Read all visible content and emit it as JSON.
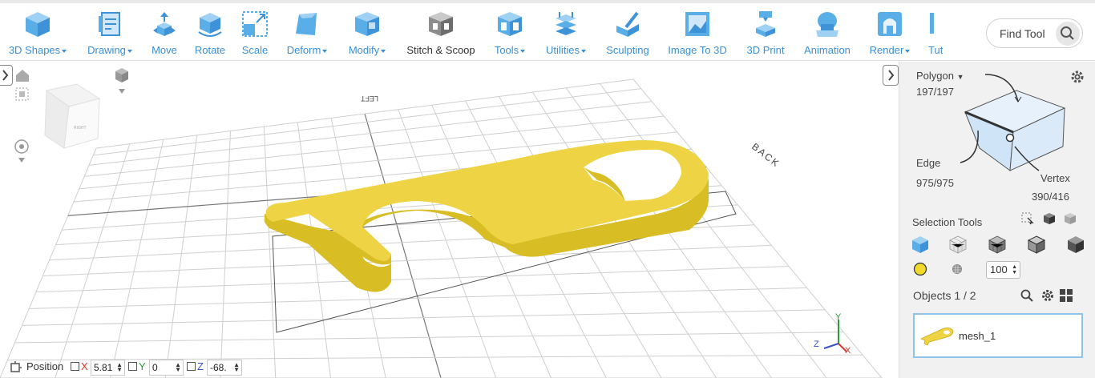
{
  "toolbar": {
    "tools": [
      {
        "label": "3D Shapes",
        "icon": "cube-icon",
        "dropdown": true
      },
      {
        "label": "Drawing",
        "icon": "drawing-icon",
        "dropdown": true
      },
      {
        "label": "Move",
        "icon": "move-icon",
        "dropdown": false
      },
      {
        "label": "Rotate",
        "icon": "rotate-icon",
        "dropdown": false
      },
      {
        "label": "Scale",
        "icon": "scale-icon",
        "dropdown": false
      },
      {
        "label": "Deform",
        "icon": "deform-icon",
        "dropdown": true
      },
      {
        "label": "Modify",
        "icon": "modify-icon",
        "dropdown": true
      },
      {
        "label": "Stitch & Scoop",
        "icon": "stitch-scoop-icon",
        "dropdown": false
      },
      {
        "label": "Tools",
        "icon": "tools-icon",
        "dropdown": true
      },
      {
        "label": "Utilities",
        "icon": "utilities-icon",
        "dropdown": true
      },
      {
        "label": "Sculpting",
        "icon": "sculpting-icon",
        "dropdown": false
      },
      {
        "label": "Image To 3D",
        "icon": "image-to-3d-icon",
        "dropdown": false
      },
      {
        "label": "3D Print",
        "icon": "3d-print-icon",
        "dropdown": false
      },
      {
        "label": "Animation",
        "icon": "animation-icon",
        "dropdown": false
      },
      {
        "label": "Render",
        "icon": "render-icon",
        "dropdown": true
      },
      {
        "label": "Tut",
        "icon": "tutorials-icon",
        "dropdown": false
      }
    ],
    "find_tool": "Find Tool"
  },
  "viewport": {
    "labels": {
      "left": "LEFT",
      "back": "BACK",
      "right": "RIGHT"
    },
    "axis_labels": {
      "x": "X",
      "y": "Y",
      "z": "Z"
    },
    "model_color": "#eed444"
  },
  "status": {
    "position_label": "Position",
    "x_label": "X",
    "x_value": "5.81",
    "y_label": "Y",
    "y_value": "0",
    "z_label": "Z",
    "z_value": "-68."
  },
  "panel": {
    "mode": "Polygon",
    "polygon_count": "197/197",
    "edge_label": "Edge",
    "edge_count": "975/975",
    "vertex_label": "Vertex",
    "vertex_count": "390/416",
    "selection_tools": "Selection Tools",
    "brush_size": "100",
    "objects_label": "Objects 1 / 2",
    "object_name": "mesh_1",
    "colors": {
      "accent": "#3b8fd6",
      "select_yellow": "#f2da2c"
    }
  }
}
